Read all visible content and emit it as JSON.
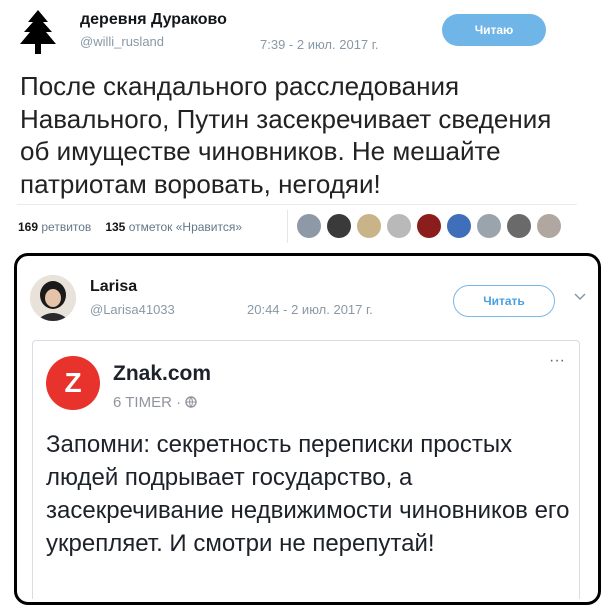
{
  "tweet": {
    "display_name": "деревня Дураково",
    "handle": "@willi_rusland",
    "timestamp": "7:39 - 2 июл. 2017 г.",
    "follow_label": "Читаю",
    "text": "После скандального расследования Навального, Путин засекречивает сведения об имуществе чиновников. Не мешайте патриотам воровать, негодяи!",
    "retweets_count": "169",
    "retweets_label": "ретвитов",
    "likes_count": "135",
    "likes_label": "отметок «Нравится»",
    "liker_colors": [
      "#8d99a6",
      "#3a3a3a",
      "#c9b48a",
      "#b9b9b9",
      "#8c1d1d",
      "#3f6fb8",
      "#9aa4ad",
      "#6a6a6a",
      "#b0a8a0"
    ]
  },
  "embedded_tweet": {
    "display_name": "Larisa",
    "handle": "@Larisa41033",
    "timestamp": "20:44 - 2 июл. 2017 г.",
    "follow_label": "Читать"
  },
  "fb_post": {
    "page_name": "Znak.com",
    "logo_letter": "Z",
    "meta": "6 TIMER · ",
    "more_label": "···",
    "text": "Запомни: секретность переписки простых людей подрывает государство, а засекречивание недвижимости чиновников его укрепляет. И смотри не перепутай!"
  },
  "colors": {
    "znak_red": "#e8332c",
    "twitter_blue": "#6fb5e8",
    "muted_text": "#8899a6"
  }
}
